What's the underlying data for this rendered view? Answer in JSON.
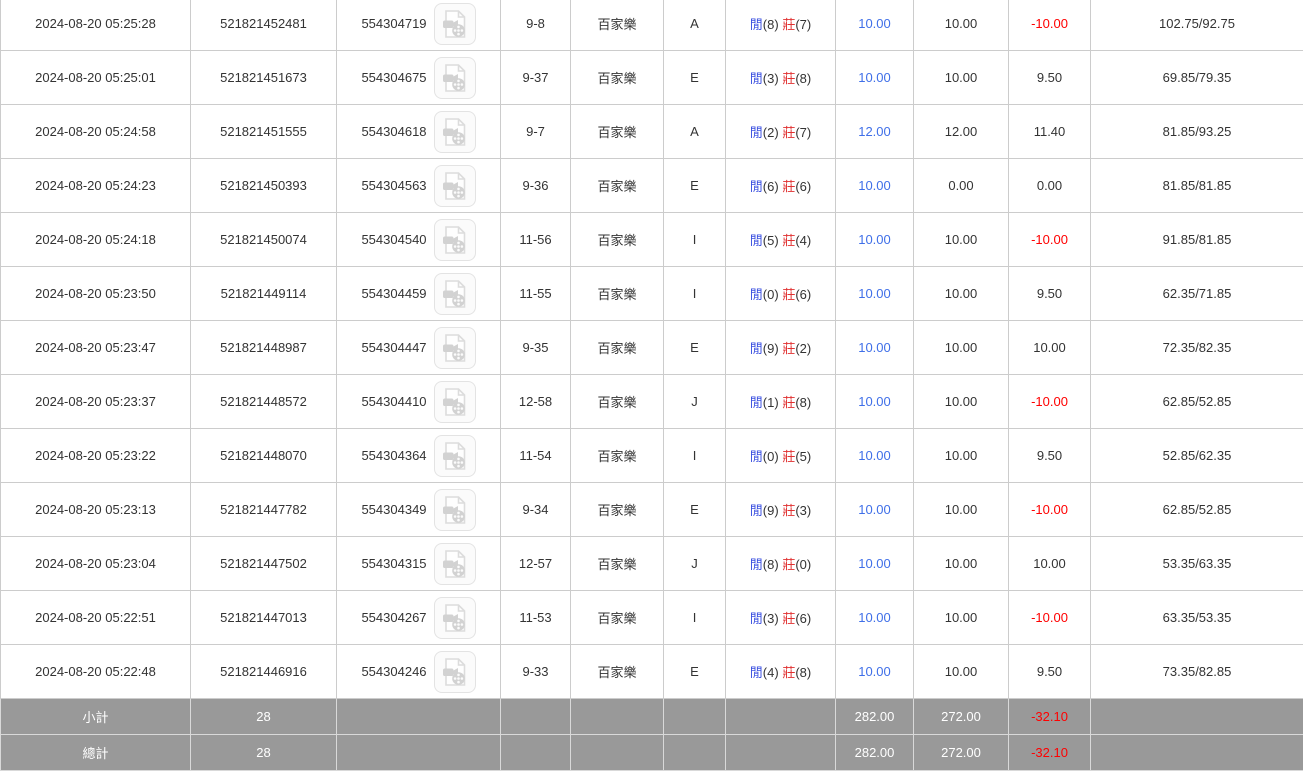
{
  "labels": {
    "player": "閒",
    "banker": "莊"
  },
  "icons": {
    "video_replay": "video-replay-icon"
  },
  "colors": {
    "link_blue": "#3f6fe8",
    "player_blue": "#3a4fe0",
    "banker_red": "#e03030",
    "negative_red": "#ff0000",
    "summary_bg": "#999999",
    "border_gray": "#cccccc",
    "text": "#333333"
  },
  "table": {
    "rows": [
      {
        "time": "2024-08-20 05:25:28",
        "bet_id": "521821452481",
        "game_id": "554304719",
        "round": "9-8",
        "game": "百家樂",
        "table": "A",
        "player_score": "(8)",
        "banker_score": "(7)",
        "bet": "10.00",
        "valid": "10.00",
        "winloss": "-10.00",
        "balance": "102.75/92.75"
      },
      {
        "time": "2024-08-20 05:25:01",
        "bet_id": "521821451673",
        "game_id": "554304675",
        "round": "9-37",
        "game": "百家樂",
        "table": "E",
        "player_score": "(3)",
        "banker_score": "(8)",
        "bet": "10.00",
        "valid": "10.00",
        "winloss": "9.50",
        "balance": "69.85/79.35"
      },
      {
        "time": "2024-08-20 05:24:58",
        "bet_id": "521821451555",
        "game_id": "554304618",
        "round": "9-7",
        "game": "百家樂",
        "table": "A",
        "player_score": "(2)",
        "banker_score": "(7)",
        "bet": "12.00",
        "valid": "12.00",
        "winloss": "11.40",
        "balance": "81.85/93.25"
      },
      {
        "time": "2024-08-20 05:24:23",
        "bet_id": "521821450393",
        "game_id": "554304563",
        "round": "9-36",
        "game": "百家樂",
        "table": "E",
        "player_score": "(6)",
        "banker_score": "(6)",
        "bet": "10.00",
        "valid": "0.00",
        "winloss": "0.00",
        "balance": "81.85/81.85"
      },
      {
        "time": "2024-08-20 05:24:18",
        "bet_id": "521821450074",
        "game_id": "554304540",
        "round": "11-56",
        "game": "百家樂",
        "table": "I",
        "player_score": "(5)",
        "banker_score": "(4)",
        "bet": "10.00",
        "valid": "10.00",
        "winloss": "-10.00",
        "balance": "91.85/81.85"
      },
      {
        "time": "2024-08-20 05:23:50",
        "bet_id": "521821449114",
        "game_id": "554304459",
        "round": "11-55",
        "game": "百家樂",
        "table": "I",
        "player_score": "(0)",
        "banker_score": "(6)",
        "bet": "10.00",
        "valid": "10.00",
        "winloss": "9.50",
        "balance": "62.35/71.85"
      },
      {
        "time": "2024-08-20 05:23:47",
        "bet_id": "521821448987",
        "game_id": "554304447",
        "round": "9-35",
        "game": "百家樂",
        "table": "E",
        "player_score": "(9)",
        "banker_score": "(2)",
        "bet": "10.00",
        "valid": "10.00",
        "winloss": "10.00",
        "balance": "72.35/82.35"
      },
      {
        "time": "2024-08-20 05:23:37",
        "bet_id": "521821448572",
        "game_id": "554304410",
        "round": "12-58",
        "game": "百家樂",
        "table": "J",
        "player_score": "(1)",
        "banker_score": "(8)",
        "bet": "10.00",
        "valid": "10.00",
        "winloss": "-10.00",
        "balance": "62.85/52.85"
      },
      {
        "time": "2024-08-20 05:23:22",
        "bet_id": "521821448070",
        "game_id": "554304364",
        "round": "11-54",
        "game": "百家樂",
        "table": "I",
        "player_score": "(0)",
        "banker_score": "(5)",
        "bet": "10.00",
        "valid": "10.00",
        "winloss": "9.50",
        "balance": "52.85/62.35"
      },
      {
        "time": "2024-08-20 05:23:13",
        "bet_id": "521821447782",
        "game_id": "554304349",
        "round": "9-34",
        "game": "百家樂",
        "table": "E",
        "player_score": "(9)",
        "banker_score": "(3)",
        "bet": "10.00",
        "valid": "10.00",
        "winloss": "-10.00",
        "balance": "62.85/52.85"
      },
      {
        "time": "2024-08-20 05:23:04",
        "bet_id": "521821447502",
        "game_id": "554304315",
        "round": "12-57",
        "game": "百家樂",
        "table": "J",
        "player_score": "(8)",
        "banker_score": "(0)",
        "bet": "10.00",
        "valid": "10.00",
        "winloss": "10.00",
        "balance": "53.35/63.35"
      },
      {
        "time": "2024-08-20 05:22:51",
        "bet_id": "521821447013",
        "game_id": "554304267",
        "round": "11-53",
        "game": "百家樂",
        "table": "I",
        "player_score": "(3)",
        "banker_score": "(6)",
        "bet": "10.00",
        "valid": "10.00",
        "winloss": "-10.00",
        "balance": "63.35/53.35"
      },
      {
        "time": "2024-08-20 05:22:48",
        "bet_id": "521821446916",
        "game_id": "554304246",
        "round": "9-33",
        "game": "百家樂",
        "table": "E",
        "player_score": "(4)",
        "banker_score": "(8)",
        "bet": "10.00",
        "valid": "10.00",
        "winloss": "9.50",
        "balance": "73.35/82.85"
      }
    ],
    "summary": [
      {
        "label": "小計",
        "count": "28",
        "bet_total": "282.00",
        "valid_total": "272.00",
        "winloss_total": "-32.10"
      },
      {
        "label": "總計",
        "count": "28",
        "bet_total": "282.00",
        "valid_total": "272.00",
        "winloss_total": "-32.10"
      }
    ]
  }
}
